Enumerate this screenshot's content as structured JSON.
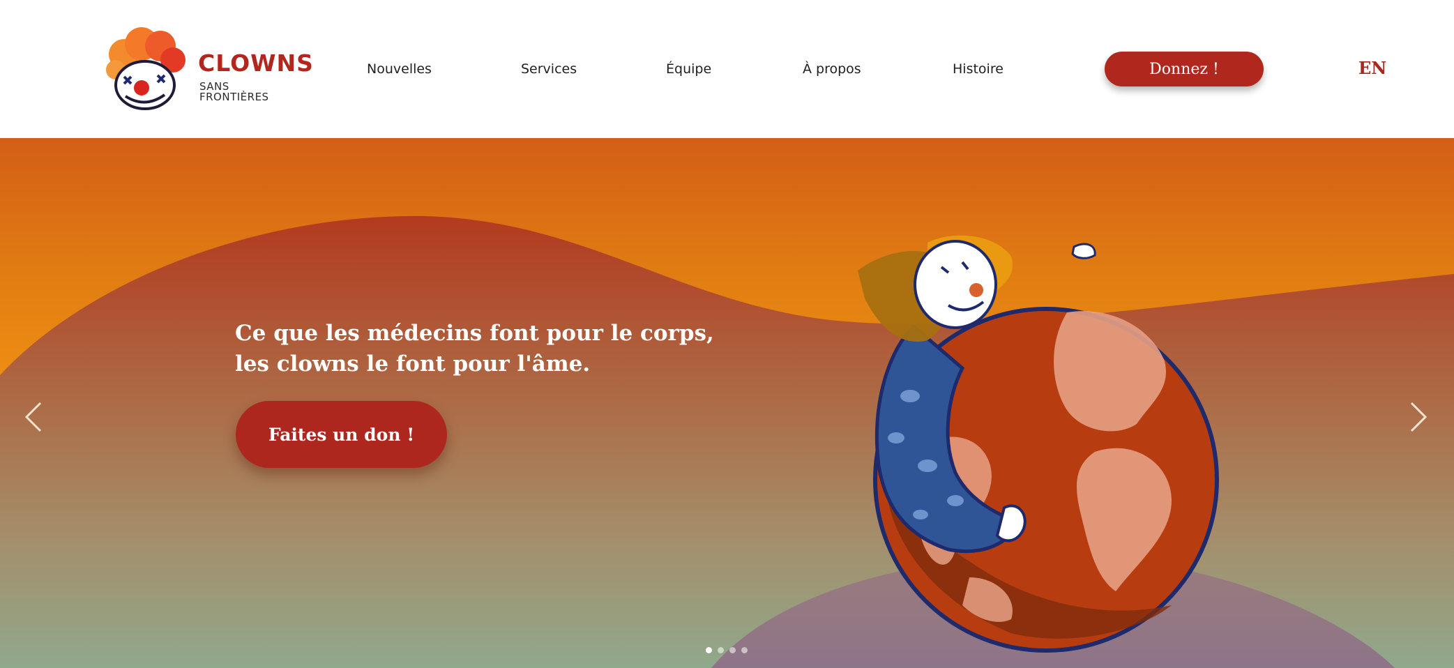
{
  "brand": {
    "name": "CLOWNS",
    "tagline": "SANS FRONTIÈRES",
    "color": "#b3261e"
  },
  "nav": {
    "items": [
      {
        "label": "Nouvelles"
      },
      {
        "label": "Services"
      },
      {
        "label": "Équipe"
      },
      {
        "label": "À propos"
      },
      {
        "label": "Histoire"
      }
    ],
    "donate_label": "Donnez !",
    "lang_label": "EN"
  },
  "hero": {
    "title_line1": "Ce que les médecins font pour le corps,",
    "title_line2": "les clowns le font pour l'âme.",
    "cta_label": "Faites un don !",
    "prev_icon": "chevron-left-icon",
    "next_icon": "chevron-right-icon",
    "slides_total": 4,
    "active_slide": 1
  },
  "colors": {
    "accent": "#b0271e",
    "hero_top": "#d05f16",
    "hero_bottom": "#9fa98e",
    "globe": "#b33c10",
    "globe_outline": "#1e2a6b"
  }
}
